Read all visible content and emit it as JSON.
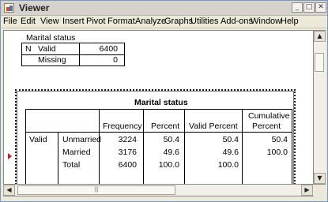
{
  "window": {
    "title": "Viewer",
    "controls": [
      "_",
      "□",
      "✕"
    ]
  },
  "menu": [
    "File",
    "Edit",
    "View",
    "Insert",
    "Pivot",
    "Format",
    "Analyze",
    "Graphs",
    "Utilities",
    "Add-ons",
    "Window",
    "Help"
  ],
  "summary_table": {
    "title": "Marital status",
    "row_label": "N",
    "rows": [
      {
        "label": "Valid",
        "value": "6400"
      },
      {
        "label": "Missing",
        "value": "0"
      }
    ]
  },
  "frequency_table": {
    "title": "Marital status",
    "headers": {
      "frequency": "Frequency",
      "percent": "Percent",
      "valid_percent": "Valid Percent",
      "cumulative_1": "Cumulative",
      "cumulative_2": "Percent"
    },
    "group_label": "Valid",
    "rows": [
      {
        "label": "Unmarried",
        "frequency": "3224",
        "percent": "50.4",
        "valid_percent": "50.4",
        "cumulative": "50.4"
      },
      {
        "label": "Married",
        "frequency": "3176",
        "percent": "49.6",
        "valid_percent": "49.6",
        "cumulative": "100.0"
      },
      {
        "label": "Total",
        "frequency": "6400",
        "percent": "100.0",
        "valid_percent": "100.0",
        "cumulative": ""
      }
    ]
  },
  "scrollbars": {
    "arrows": {
      "up": "▲",
      "down": "▼",
      "left": "◀",
      "right": "▶"
    },
    "grip": "|||"
  }
}
